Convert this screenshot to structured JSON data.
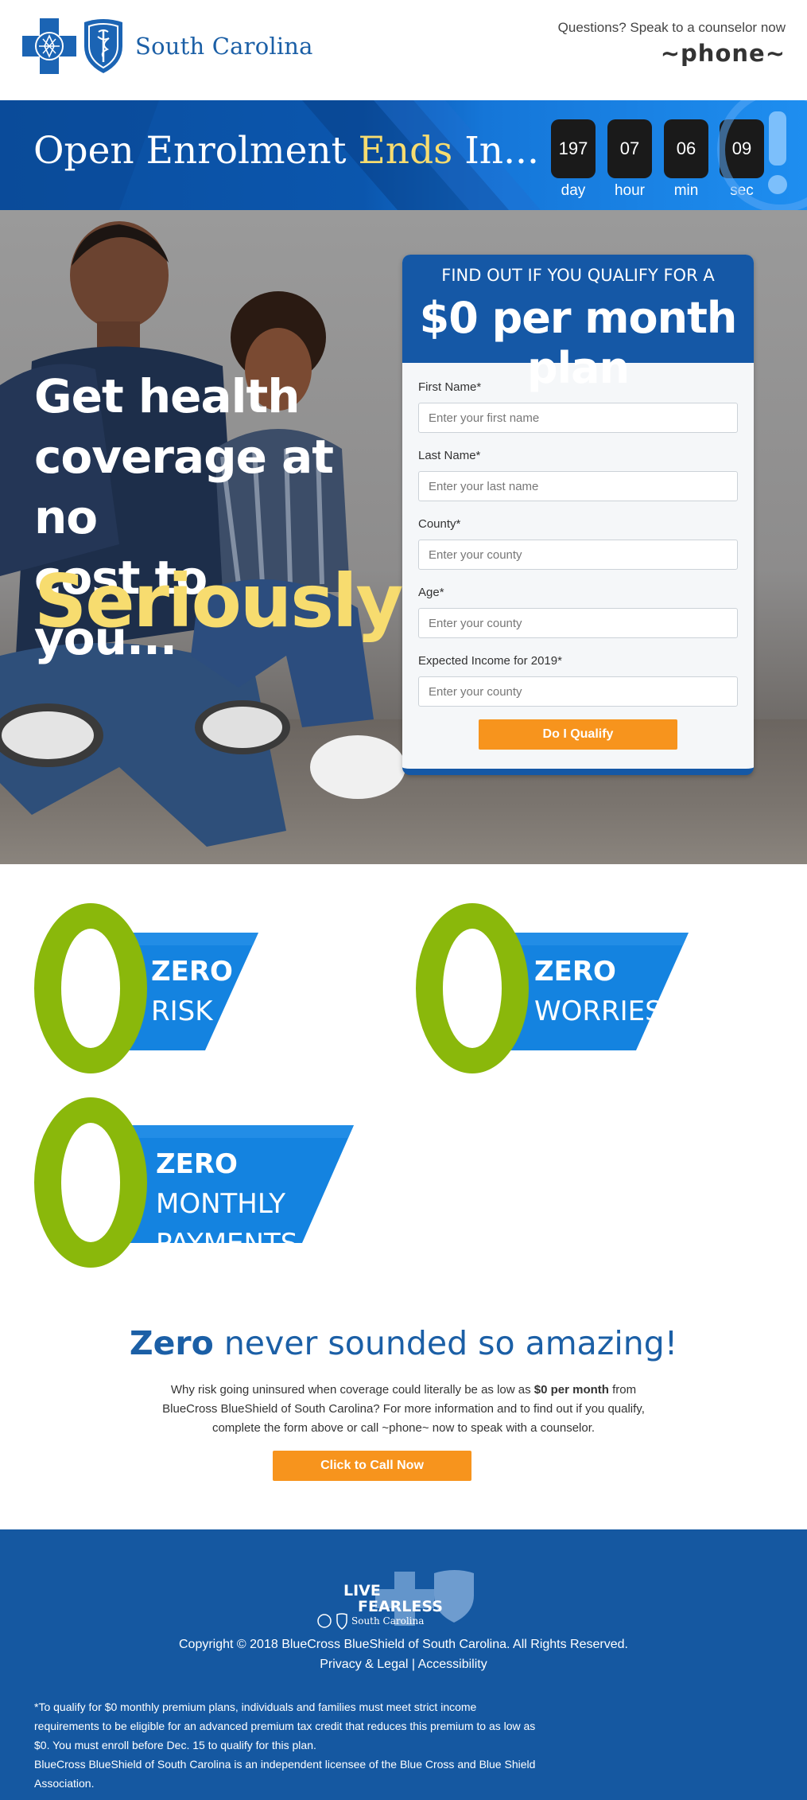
{
  "header": {
    "brand_name": "South Carolina",
    "questions_text": "Questions? Speak to a counselor now",
    "phone": "~phone~"
  },
  "banner": {
    "title_part1": "Open Enrolment ",
    "title_highlight": "Ends",
    "title_part2": " In...",
    "countdown": [
      {
        "value": "197",
        "label": "day"
      },
      {
        "value": "07",
        "label": "hour"
      },
      {
        "value": "06",
        "label": "min"
      },
      {
        "value": "09",
        "label": "sec"
      }
    ],
    "accent_color": "#f7dc6f"
  },
  "hero": {
    "headline_line1": "Get health",
    "headline_line2": "coverage at no",
    "headline_line3": "cost to you...",
    "big_word": "Seriously"
  },
  "form": {
    "subtitle": "FIND OUT IF YOU QUALIFY FOR A",
    "title": "$0 per month plan",
    "fields": [
      {
        "label": "First Name*",
        "placeholder": "Enter your first name"
      },
      {
        "label": "Last Name*",
        "placeholder": "Enter your last name"
      },
      {
        "label": "County*",
        "placeholder": "Enter your county"
      },
      {
        "label": "Age*",
        "placeholder": "Enter your county"
      },
      {
        "label": "Expected Income for 2019*",
        "placeholder": "Enter your county"
      }
    ],
    "submit_label": "Do I Qualify",
    "header_color": "#1558a6",
    "button_color": "#f7941d"
  },
  "features": [
    {
      "bold": "ZERO",
      "rest": "RISK"
    },
    {
      "bold": "ZERO",
      "rest": "WORRIES"
    },
    {
      "bold": "ZERO",
      "rest_inline": " MONTHLY",
      "rest": "PAYMENTS"
    }
  ],
  "middle": {
    "title_bold": "Zero",
    "title_rest": " never sounded so amazing!",
    "text_before": "Why risk going uninsured when coverage could literally be as low as ",
    "text_bold": "$0 per month",
    "text_after": " from BlueCross BlueShield of South Carolina? For more information and to find out if you qualify, complete the form above or call ~phone~ now to speak with a counselor.",
    "call_label": "Click to Call Now"
  },
  "footer": {
    "logo_line1": "LIVE",
    "logo_line2": "FEARLESS",
    "logo_sub": "South Carolina",
    "copyright": "Copyright © 2018 BlueCross BlueShield of South Carolina. All Rights Reserved.",
    "privacy_label": "Privacy & Legal",
    "separator": " | ",
    "accessibility_label": "Accessibility",
    "disclaimer_1": "*To qualify for $0 monthly premium plans, individuals and families must meet strict income requirements to be eligible for an advanced premium tax credit that reduces this premium to as low as $0. You must enroll before Dec. 15 to qualify for this plan.",
    "disclaimer_2": "BlueCross BlueShield of South Carolina is an independent licensee of the Blue Cross and Blue Shield Association."
  }
}
